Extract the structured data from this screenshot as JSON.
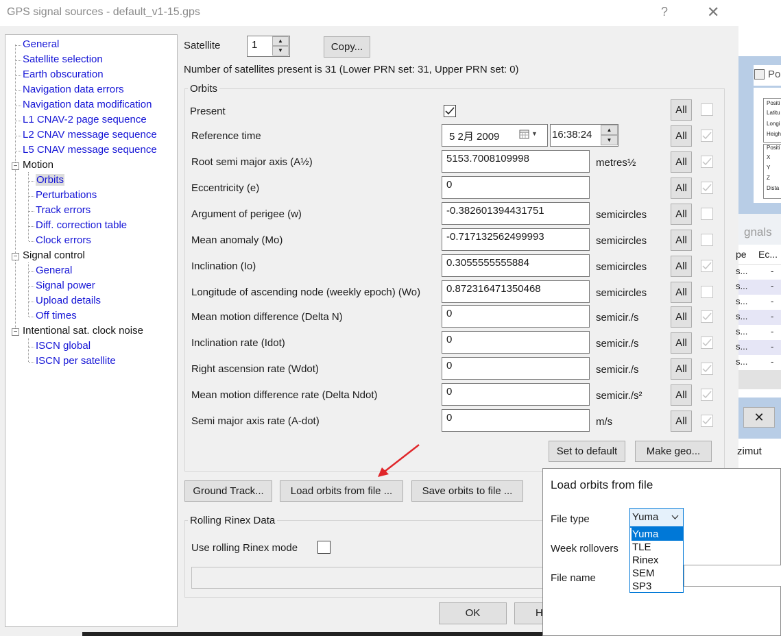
{
  "window": {
    "title": "GPS signal sources - default_v1-15.gps",
    "help": "?",
    "close": "✕"
  },
  "tree": {
    "items": [
      {
        "label": "General"
      },
      {
        "label": "Satellite selection"
      },
      {
        "label": "Earth obscuration"
      },
      {
        "label": "Navigation data errors"
      },
      {
        "label": "Navigation data modification"
      },
      {
        "label": "L1 CNAV-2 page sequence"
      },
      {
        "label": "L2 CNAV message sequence"
      },
      {
        "label": "L5 CNAV message sequence"
      },
      {
        "label": "Motion"
      },
      {
        "label": "Orbits"
      },
      {
        "label": "Perturbations"
      },
      {
        "label": "Track errors"
      },
      {
        "label": "Diff. correction table"
      },
      {
        "label": "Clock errors"
      },
      {
        "label": "Signal control"
      },
      {
        "label": "General"
      },
      {
        "label": "Signal power"
      },
      {
        "label": "Upload details"
      },
      {
        "label": "Off times"
      },
      {
        "label": "Intentional sat. clock noise"
      },
      {
        "label": "ISCN global"
      },
      {
        "label": "ISCN per satellite"
      }
    ],
    "expander": "−"
  },
  "satellite": {
    "label": "Satellite",
    "value": "1",
    "copy_button": "Copy...",
    "count_text": "Number of satellites present is  31  (Lower PRN set: 31, Upper PRN set: 0)"
  },
  "orbits": {
    "group_title": "Orbits",
    "all_label": "All",
    "present_label": "Present",
    "reference_time": {
      "label": "Reference time",
      "date": "5  2月  2009",
      "time": "16:38:24"
    },
    "rows": [
      {
        "label": "Root semi major axis (A½)",
        "value": "5153.7008109998",
        "unit": "metres½"
      },
      {
        "label": "Eccentricity (e)",
        "value": "0",
        "unit": ""
      },
      {
        "label": "Argument of perigee (w)",
        "value": "-0.382601394431751",
        "unit": "semicircles"
      },
      {
        "label": "Mean anomaly (Mo)",
        "value": "-0.717132562499993",
        "unit": "semicircles"
      },
      {
        "label": "Inclination (Io)",
        "value": "0.3055555555884",
        "unit": "semicircles"
      },
      {
        "label": "Longitude of ascending node (weekly epoch) (Wo)",
        "value": "0.872316471350468",
        "unit": "semicircles"
      },
      {
        "label": "Mean motion difference (Delta N)",
        "value": "0",
        "unit": "semicir./s"
      },
      {
        "label": "Inclination rate (Idot)",
        "value": "0",
        "unit": "semicir./s"
      },
      {
        "label": "Right ascension rate (Wdot)",
        "value": "0",
        "unit": "semicir./s"
      },
      {
        "label": " Mean motion difference rate (Delta Ndot)",
        "value": "0",
        "unit": "semicir./s²"
      },
      {
        "label": "Semi major axis rate (A-dot)",
        "value": "0",
        "unit": "m/s"
      }
    ],
    "set_default_button": "Set to default",
    "make_geo_button": "Make geo..."
  },
  "buttons": {
    "ground_track": "Ground Track...",
    "load_orbits": "Load orbits from file ...",
    "save_orbits": "Save orbits to file ...",
    "ok": "OK",
    "partial": "H"
  },
  "rinex": {
    "group_title": "Rolling Rinex Data",
    "mode_label": "Use rolling Rinex mode"
  },
  "popup": {
    "title": "Load orbits from file",
    "file_type_label": "File type",
    "file_type_selected": "Yuma",
    "options": [
      "Yuma",
      "TLE",
      "Rinex",
      "SEM",
      "SP3"
    ],
    "week_rollovers_label": "Week rollovers",
    "file_name_label": "File name"
  },
  "background": {
    "tab_fragment": "Po",
    "box1_lines": [
      "Positi",
      "Latitu",
      "Longi",
      "Heigh"
    ],
    "box2_lines": [
      "Positi",
      "X",
      "Y",
      "Z",
      "Dista"
    ],
    "signals_label": "gnals",
    "col1": "pe",
    "col2": "Ec...",
    "rows": [
      {
        "a": "s...",
        "b": "-"
      },
      {
        "a": "s...",
        "b": "-"
      },
      {
        "a": "s...",
        "b": "-"
      },
      {
        "a": "s...",
        "b": "-"
      },
      {
        "a": "s...",
        "b": "-"
      },
      {
        "a": "s...",
        "b": "-"
      },
      {
        "a": "s...",
        "b": "-"
      }
    ],
    "close": "✕",
    "azimuth": "zimut"
  },
  "colors": {
    "link": "#1515d6",
    "arrow": "#e0262a",
    "highlight": "#0078d7"
  }
}
